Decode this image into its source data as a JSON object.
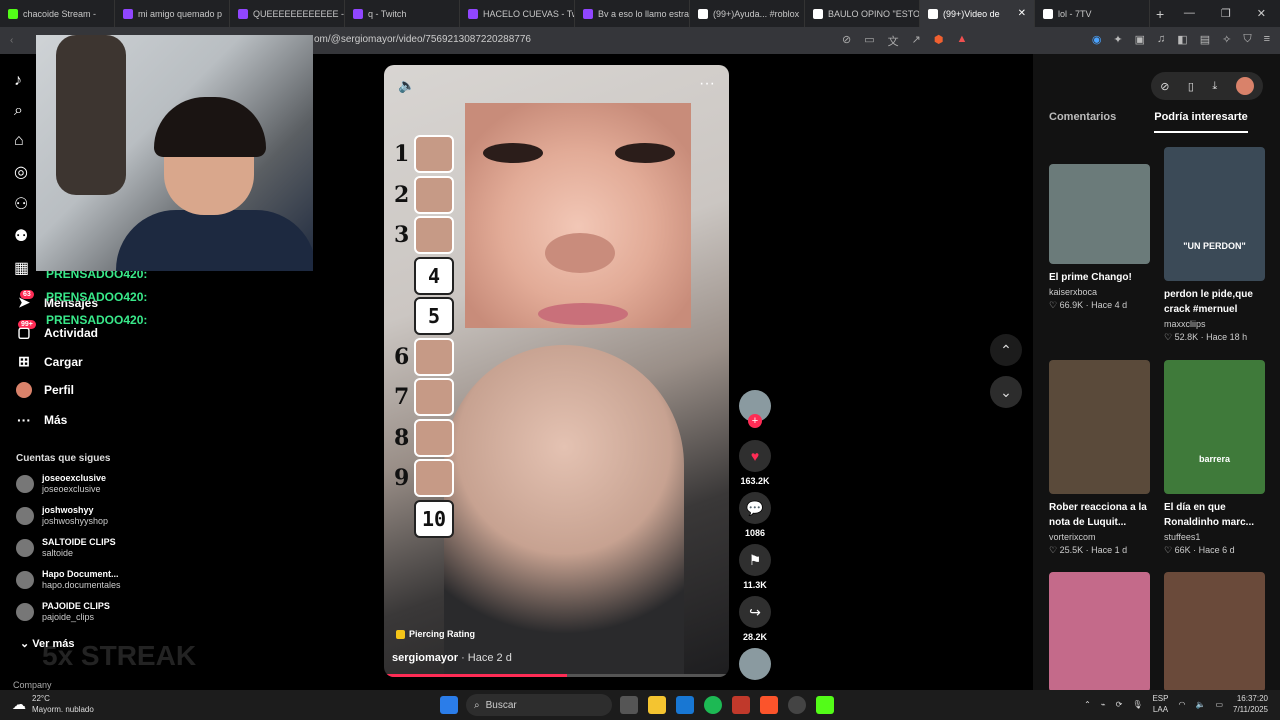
{
  "browser": {
    "tabs": [
      {
        "label": "chacoide Stream -",
        "color": "#53fc18"
      },
      {
        "label": "mi amigo quemado p",
        "color": "#9146ff"
      },
      {
        "label": "QUEEEEEEEEEEEE - Tw",
        "color": "#9146ff"
      },
      {
        "label": "q - Twitch",
        "color": "#9146ff"
      },
      {
        "label": "HACELO CUEVAS - Twi",
        "color": "#9146ff"
      },
      {
        "label": "Bv a eso lo llamo estra",
        "color": "#9146ff"
      },
      {
        "label": "(99+)Ayuda... #roblox",
        "color": "#ffffff"
      },
      {
        "label": "BAULO OPINO \"ESTO",
        "color": "#ffffff"
      },
      {
        "label": "(99+)Video de",
        "color": "#ffffff",
        "active": true
      },
      {
        "label": "lol - 7TV",
        "color": "#ffffff"
      }
    ],
    "url": "om/@sergiomayor/video/7569213087220288776",
    "new_tab": "+"
  },
  "sidebar": {
    "items": [
      {
        "label": "Mensajes",
        "badge": "63",
        "icon": "send-icon"
      },
      {
        "label": "Actividad",
        "badge": "99+",
        "icon": "inbox-icon"
      },
      {
        "label": "Cargar",
        "icon": "plus-square-icon"
      },
      {
        "label": "Perfil",
        "icon": "avatar"
      },
      {
        "label": "Más",
        "icon": "more-icon"
      }
    ],
    "chat_lines": [
      "PRENSADOO420:",
      "PRENSADOO420:",
      "PRENSADOO420:"
    ],
    "following_title": "Cuentas que sigues",
    "following": [
      {
        "name": "joseoexclusive",
        "handle": "joseoexclusive"
      },
      {
        "name": "joshwoshyy",
        "handle": "joshwoshyyshop"
      },
      {
        "name": "SALTOIDE CLIPS",
        "handle": "saltoide"
      },
      {
        "name": "Hapo Document...",
        "handle": "hapo.documentales"
      },
      {
        "name": "PAJOIDE CLIPS",
        "handle": "pajoide_clips"
      }
    ],
    "see_more": "Ver más",
    "company": "Company",
    "streak": "5x STREAK"
  },
  "video": {
    "ranks": [
      "1",
      "2",
      "3",
      "4",
      "5",
      "6",
      "7",
      "8",
      "9",
      "10"
    ],
    "tag": "Piercing Rating",
    "author": "sergiomayor",
    "ago": " · Hace 2 d",
    "progress": 0.53
  },
  "actions": {
    "likes": "163.2K",
    "comments": "1086",
    "saves": "11.3K",
    "shares": "28.2K"
  },
  "right_panel": {
    "tabs": [
      "Comentarios",
      "Podría interesarte"
    ],
    "cards": [
      {
        "title": "El prime Chango!",
        "author": "kaiserxboca",
        "meta": "♡ 66.9K · Hace 4 d",
        "color": "#6b7b7a"
      },
      {
        "title": "perdon le pide,que crack #mernuel",
        "author": "maxxcliips",
        "meta": "♡ 52.8K · Hace 18 h",
        "color": "#3b4a57",
        "overlay": "\"UN PERDON\""
      },
      {
        "title": "Rober reacciona a la nota de Luquit...",
        "author": "vorterixcom",
        "meta": "♡ 25.5K · Hace 1 d",
        "color": "#5a4a3a"
      },
      {
        "title": "El día en que Ronaldinho marc...",
        "author": "stuffees1",
        "meta": "♡ 66K · Hace 6 d",
        "color": "#3f7a3a",
        "overlay": "barrera"
      },
      {
        "title": "",
        "author": "",
        "meta": "",
        "color": "#c46a8a"
      },
      {
        "title": "",
        "author": "",
        "meta": "",
        "color": "#6a4a3a"
      }
    ]
  },
  "taskbar": {
    "temp": "22°C",
    "weather": "Mayorm. nublado",
    "search": "Buscar",
    "lang": "ESP",
    "lang2": "LAA",
    "time": "16:37:20",
    "date": "7/11/2025"
  }
}
